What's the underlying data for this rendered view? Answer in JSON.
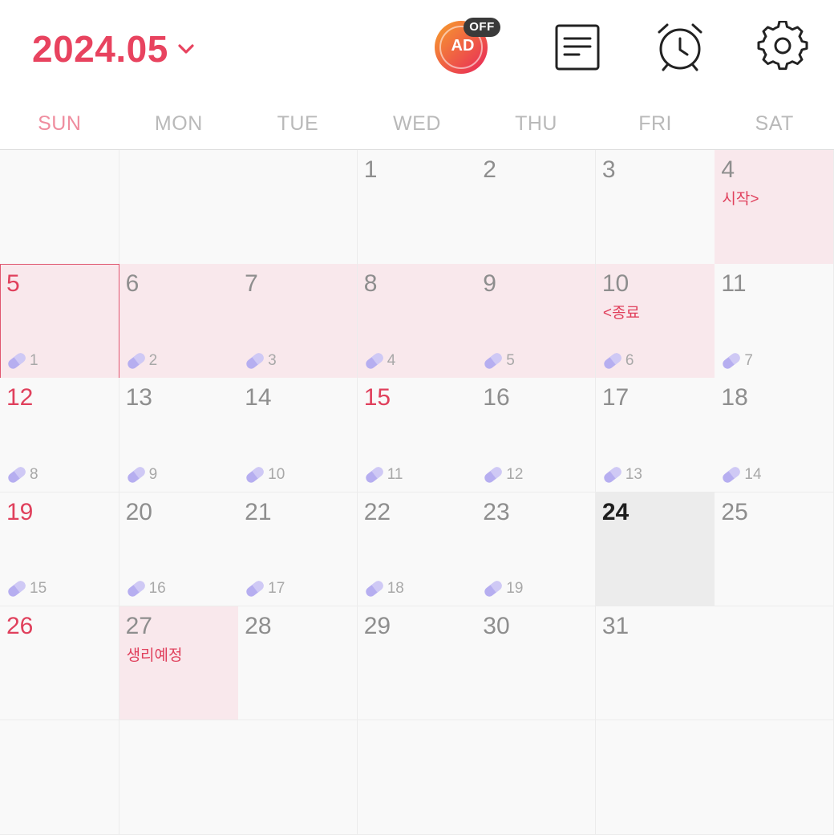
{
  "header": {
    "month_label": "2024.05",
    "ad_label": "AD",
    "ad_badge": "OFF"
  },
  "weekdays": [
    "SUN",
    "MON",
    "TUE",
    "WED",
    "THU",
    "FRI",
    "SAT"
  ],
  "colors": {
    "accent": "#e8435f",
    "period_bg": "#f9e8ec",
    "today_bg": "#ececec",
    "pill": "#b6aef0"
  },
  "icons": {
    "memo": "memo-list-icon",
    "alarm": "alarm-clock-icon",
    "settings": "gear-icon",
    "ad_toggle": "ad-toggle-icon",
    "pill": "pill-icon",
    "dropdown": "chevron-down-icon"
  },
  "calendar": {
    "weeks": [
      [
        {
          "day": "",
          "type": "empty"
        },
        {
          "day": "",
          "type": "empty"
        },
        {
          "day": "",
          "type": "empty"
        },
        {
          "day": "1"
        },
        {
          "day": "2"
        },
        {
          "day": "3"
        },
        {
          "day": "4",
          "period": true,
          "note": "시작>"
        }
      ],
      [
        {
          "day": "5",
          "red": true,
          "period": true,
          "selected": true,
          "pill": "1"
        },
        {
          "day": "6",
          "period": true,
          "pill": "2"
        },
        {
          "day": "7",
          "period": true,
          "pill": "3"
        },
        {
          "day": "8",
          "period": true,
          "pill": "4"
        },
        {
          "day": "9",
          "period": true,
          "pill": "5"
        },
        {
          "day": "10",
          "period": true,
          "note": "<종료",
          "pill": "6"
        },
        {
          "day": "11",
          "pill": "7"
        }
      ],
      [
        {
          "day": "12",
          "red": true,
          "pill": "8"
        },
        {
          "day": "13",
          "pill": "9"
        },
        {
          "day": "14",
          "pill": "10"
        },
        {
          "day": "15",
          "red": true,
          "pill": "11"
        },
        {
          "day": "16",
          "pill": "12"
        },
        {
          "day": "17",
          "pill": "13"
        },
        {
          "day": "18",
          "pill": "14"
        }
      ],
      [
        {
          "day": "19",
          "red": true,
          "pill": "15"
        },
        {
          "day": "20",
          "pill": "16"
        },
        {
          "day": "21",
          "pill": "17"
        },
        {
          "day": "22",
          "pill": "18"
        },
        {
          "day": "23",
          "pill": "19"
        },
        {
          "day": "24",
          "today": true
        },
        {
          "day": "25"
        }
      ],
      [
        {
          "day": "26",
          "red": true
        },
        {
          "day": "27",
          "period": true,
          "note": "생리예정"
        },
        {
          "day": "28"
        },
        {
          "day": "29"
        },
        {
          "day": "30"
        },
        {
          "day": "31"
        },
        {
          "day": "",
          "type": "empty"
        }
      ],
      [
        {
          "day": "",
          "type": "empty"
        },
        {
          "day": "",
          "type": "empty"
        },
        {
          "day": "",
          "type": "empty"
        },
        {
          "day": "",
          "type": "empty"
        },
        {
          "day": "",
          "type": "empty"
        },
        {
          "day": "",
          "type": "empty"
        },
        {
          "day": "",
          "type": "empty"
        }
      ]
    ]
  }
}
